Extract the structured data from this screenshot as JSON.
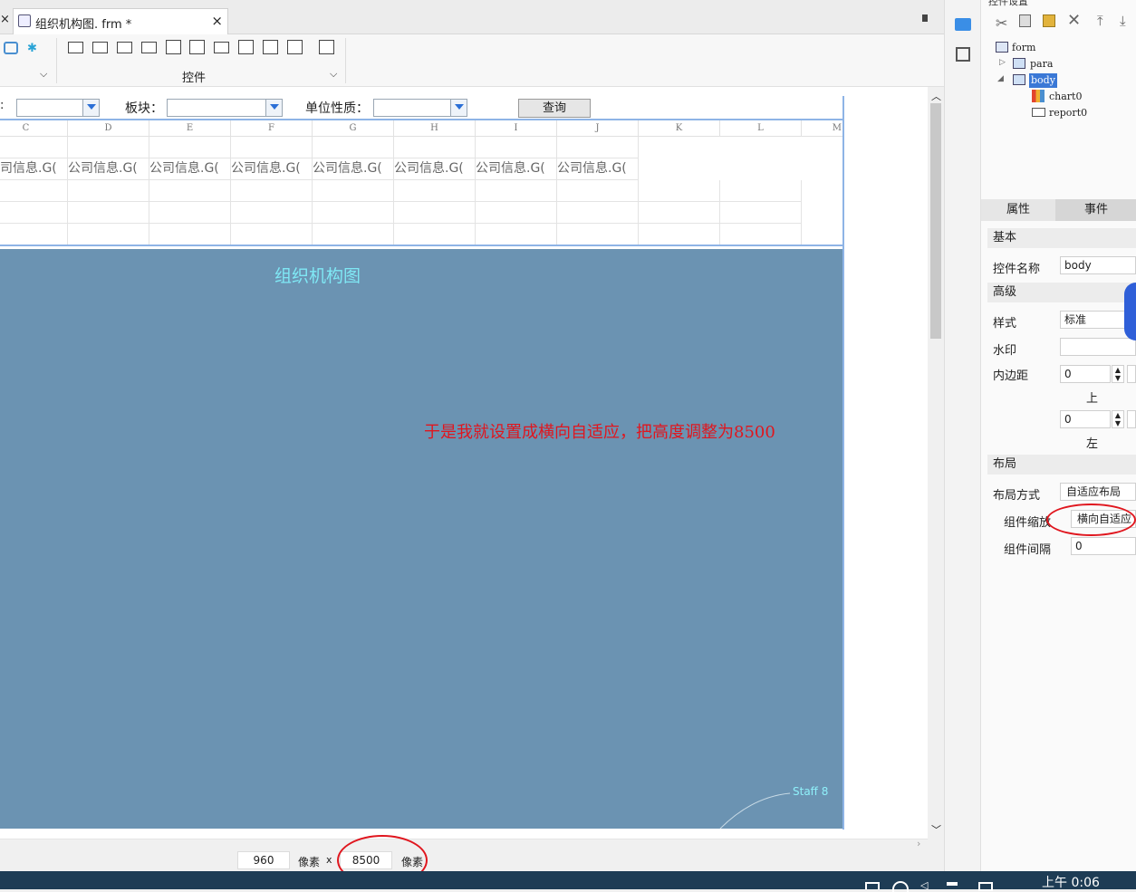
{
  "tabs": [
    {
      "label": "组织机构图. frm *",
      "close": "×"
    }
  ],
  "toolbar": {
    "group_label": "控件"
  },
  "params": {
    "label_2": "板块：",
    "label_3": "单位性质：",
    "query_button": "查询"
  },
  "grid": {
    "columns": [
      "C",
      "D",
      "E",
      "F",
      "G",
      "H",
      "I",
      "J",
      "K",
      "L",
      "M"
    ],
    "cells": [
      "司信息.G(",
      "公司信息.G(",
      "公司信息.G(",
      "公司信息.G(",
      "公司信息.G(",
      "公司信息.G(",
      "公司信息.G(",
      "公司信息.G("
    ]
  },
  "chart": {
    "title": "组织机构图",
    "note": "于是我就设置成横向自适应，把高度调整为8500",
    "node_label": "Staff 8"
  },
  "statusbar": {
    "width_value": "960",
    "width_unit": "像素",
    "times": "x",
    "height_value": "8500",
    "height_unit": "像素"
  },
  "widget_tree": {
    "title": "控件设置",
    "items": [
      "form",
      "para",
      "body",
      "chart0",
      "report0"
    ]
  },
  "properties": {
    "tabs": [
      "属性",
      "事件"
    ],
    "sections": [
      "基本",
      "高级",
      "布局"
    ],
    "name_label": "控件名称",
    "name_value": "body",
    "style_label": "样式",
    "style_value": "标准",
    "watermark_label": "水印",
    "padding_label": "内边距",
    "padding_top": "0",
    "padding_top_label": "上",
    "padding_left": "0",
    "padding_left_label": "左",
    "layout_mode_label": "布局方式",
    "layout_mode_value": "自适应布局",
    "scale_label": "组件缩放",
    "scale_value": "横向自适应",
    "gap_label": "组件间隔",
    "gap_value": "0"
  },
  "taskbar": {
    "time": "上午 0:06"
  },
  "colors": {
    "chart_bg": "#6b93b2",
    "accent": "#e0161e",
    "title": "#7fe8f5"
  }
}
